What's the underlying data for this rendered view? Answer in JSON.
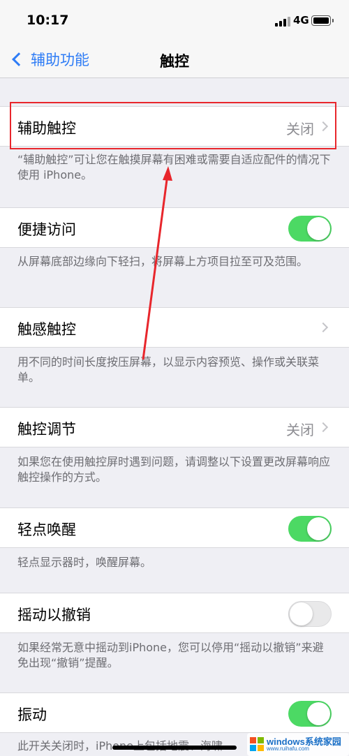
{
  "status_bar": {
    "time": "10:17",
    "network": "4G"
  },
  "nav": {
    "back_label": "辅助功能",
    "title": "触控"
  },
  "rows": [
    {
      "label": "辅助触控",
      "value": "关闭",
      "footer": "“辅助触控”可让您在触摸屏幕有困难或需要自适应配件的情况下使用 iPhone。"
    },
    {
      "label": "便捷访问",
      "toggle": "on",
      "footer": "从屏幕底部边缘向下轻扫，将屏幕上方项目拉至可及范围。"
    },
    {
      "label": "触感触控",
      "footer": "用不同的时间长度按压屏幕，以显示内容预览、操作或关联菜单。"
    },
    {
      "label": "触控调节",
      "value": "关闭",
      "footer": "如果您在使用触控屏时遇到问题，请调整以下设置更改屏幕响应触控操作的方式。"
    },
    {
      "label": "轻点唤醒",
      "toggle": "on",
      "footer": "轻点显示器时，唤醒屏幕。"
    },
    {
      "label": "摇动以撤销",
      "toggle": "off",
      "footer": "如果经常无意中摇动到iPhone，您可以停用“摇动以撤销”来避免出现“撤销”提醒。"
    },
    {
      "label": "振动",
      "toggle": "on",
      "footer": "此开关关闭时，iPhone上包括地震、海啸"
    }
  ],
  "watermark": {
    "title": "windows系统家园",
    "url": "www.ruihafu.com"
  },
  "colors": {
    "accent": "#2e7cf6",
    "toggle_on": "#4cd964",
    "annotation": "#e8262c"
  }
}
